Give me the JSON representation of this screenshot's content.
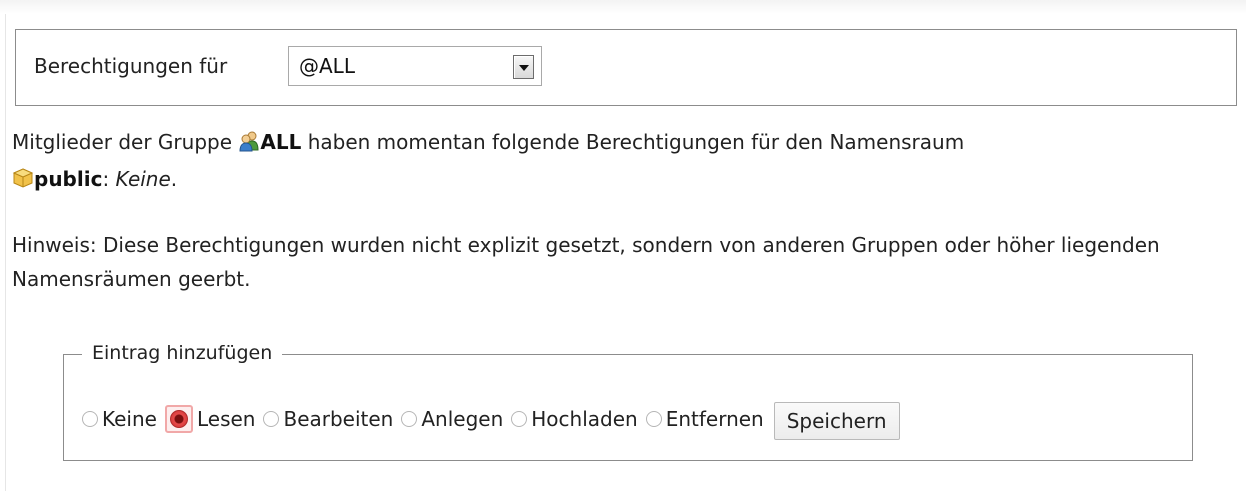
{
  "selector": {
    "label": "Berechtigungen für",
    "selected_value": "@ALL"
  },
  "info": {
    "prefix": "Mitglieder der Gruppe",
    "group_name": "ALL",
    "middle": "haben momentan folgende Berechtigungen für den Namensraum",
    "namespace_name": "public",
    "colon": ": ",
    "permission": "Keine",
    "period": "."
  },
  "hint": {
    "text": "Hinweis: Diese Berechtigungen wurden nicht explizit gesetzt, sondern von anderen Gruppen oder höher liegenden Namensräumen geerbt."
  },
  "add_entry": {
    "legend": "Eintrag hinzufügen",
    "options": [
      {
        "label": "Keine",
        "checked": false
      },
      {
        "label": "Lesen",
        "checked": true
      },
      {
        "label": "Bearbeiten",
        "checked": false
      },
      {
        "label": "Anlegen",
        "checked": false
      },
      {
        "label": "Hochladen",
        "checked": false
      },
      {
        "label": "Entfernen",
        "checked": false
      }
    ],
    "save_label": "Speichern"
  },
  "icons": {
    "group": "users-icon",
    "namespace": "box-icon"
  },
  "colors": {
    "checked_radio": "#e84a4a",
    "checked_highlight": "#fdeeee"
  }
}
